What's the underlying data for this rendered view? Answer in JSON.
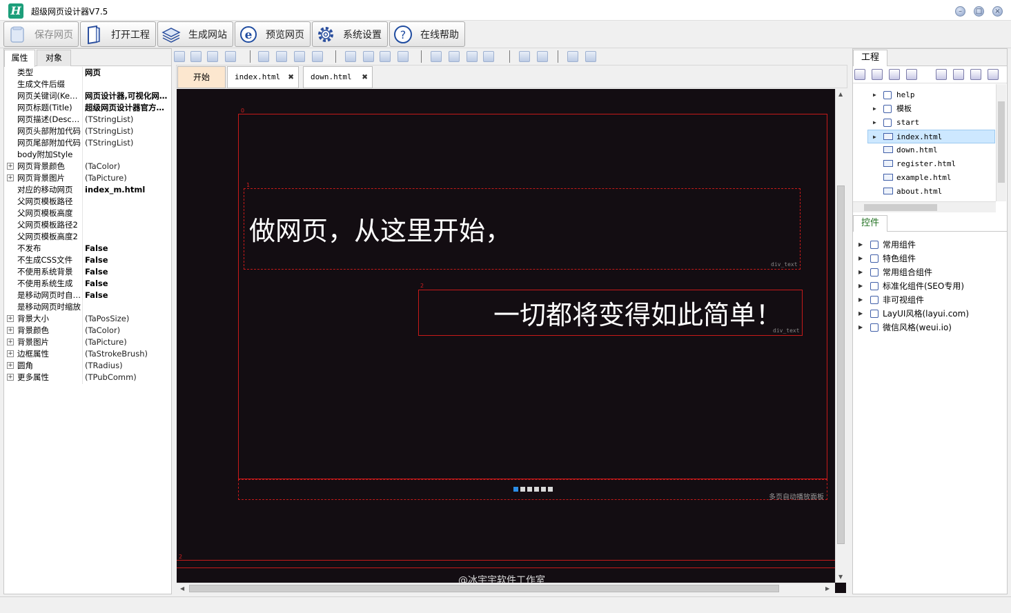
{
  "window": {
    "title": "超级网页设计器V7.5",
    "logo_letter": "H",
    "controls": [
      "minimize",
      "maximize",
      "close"
    ]
  },
  "toolbar": {
    "buttons": [
      {
        "label": "保存网页",
        "icon": "save-icon",
        "enabled": false
      },
      {
        "label": "打开工程",
        "icon": "open-project-icon",
        "enabled": true
      },
      {
        "label": "生成网站",
        "icon": "build-site-icon",
        "enabled": true
      },
      {
        "label": "预览网页",
        "icon": "browser-preview-icon",
        "enabled": true
      },
      {
        "label": "系统设置",
        "icon": "gear-icon",
        "enabled": true
      },
      {
        "label": "在线帮助",
        "icon": "help-icon",
        "enabled": true
      }
    ]
  },
  "left_panel": {
    "tabs": [
      "属性",
      "对象"
    ],
    "active_tab": "属性",
    "properties": [
      {
        "name": "类型",
        "value": "网页",
        "bold": true,
        "expandable": false
      },
      {
        "name": "生成文件后缀",
        "value": "",
        "bold": false,
        "expandable": false
      },
      {
        "name": "网页关键词(Keywords)",
        "value": "网页设计器,可视化网页设计",
        "bold": true,
        "expandable": false
      },
      {
        "name": "网页标题(Title)",
        "value": "超级网页设计器官方网站",
        "bold": true,
        "expandable": false
      },
      {
        "name": "网页描述(Description)",
        "value": "(TStringList)",
        "bold": false,
        "expandable": false
      },
      {
        "name": "网页头部附加代码",
        "value": "(TStringList)",
        "bold": false,
        "expandable": false
      },
      {
        "name": "网页尾部附加代码",
        "value": "(TStringList)",
        "bold": false,
        "expandable": false
      },
      {
        "name": "body附加Style",
        "value": "",
        "bold": false,
        "expandable": false
      },
      {
        "name": "网页背景颜色",
        "value": "(TaColor)",
        "bold": false,
        "expandable": true
      },
      {
        "name": "网页背景图片",
        "value": "(TaPicture)",
        "bold": false,
        "expandable": true
      },
      {
        "name": "对应的移动网页",
        "value": "index_m.html",
        "bold": true,
        "expandable": false
      },
      {
        "name": "父网页模板路径",
        "value": "",
        "bold": false,
        "expandable": false
      },
      {
        "name": "父网页模板高度",
        "value": "",
        "bold": false,
        "expandable": false
      },
      {
        "name": "父网页模板路径2",
        "value": "",
        "bold": false,
        "expandable": false
      },
      {
        "name": "父网页模板高度2",
        "value": "",
        "bold": false,
        "expandable": false
      },
      {
        "name": "不发布",
        "value": "False",
        "bold": true,
        "expandable": false
      },
      {
        "name": "不生成CSS文件",
        "value": "False",
        "bold": true,
        "expandable": false
      },
      {
        "name": "不使用系统背景",
        "value": "False",
        "bold": true,
        "expandable": false
      },
      {
        "name": "不使用系统生成",
        "value": "False",
        "bold": true,
        "expandable": false
      },
      {
        "name": "是移动网页时自适应",
        "value": "False",
        "bold": true,
        "expandable": false
      },
      {
        "name": "是移动网页时缩放",
        "value": "",
        "bold": false,
        "expandable": false
      },
      {
        "name": "背景大小",
        "value": "(TaPosSize)",
        "bold": false,
        "expandable": true
      },
      {
        "name": "背景颜色",
        "value": "(TaColor)",
        "bold": false,
        "expandable": true
      },
      {
        "name": "背景图片",
        "value": "(TaPicture)",
        "bold": false,
        "expandable": true
      },
      {
        "name": "边框属性",
        "value": "(TaStrokeBrush)",
        "bold": false,
        "expandable": true
      },
      {
        "name": "圆角",
        "value": "(TRadius)",
        "bold": false,
        "expandable": true
      },
      {
        "name": "更多属性",
        "value": "(TPubComm)",
        "bold": false,
        "expandable": true
      }
    ]
  },
  "doc_tabs": [
    {
      "label": "开始",
      "closable": false,
      "kind": "start"
    },
    {
      "label": "index.html",
      "closable": true,
      "kind": "doc"
    },
    {
      "label": "down.html",
      "closable": true,
      "kind": "doc"
    }
  ],
  "canvas": {
    "background": "#130d12",
    "accent_red": "#c81a1a",
    "block_indices": [
      "0",
      "1",
      "2",
      "2"
    ],
    "hero_text_1": "做网页，从这里开始，",
    "hero_text_2": "一切都将变得如此简单！",
    "div_tag": "div_text",
    "carousel_label": "多页自动播放面板",
    "carousel_dot_count": 6,
    "carousel_active_dot": 1,
    "footer_text": "@冰宇宇软件工作室"
  },
  "right_panel": {
    "project_tab": "工程",
    "tree": [
      {
        "label": "help",
        "icon": "page-icon",
        "expandable": true,
        "selected": false
      },
      {
        "label": "模板",
        "icon": "page-icon",
        "expandable": true,
        "selected": false
      },
      {
        "label": "start",
        "icon": "page-icon",
        "expandable": true,
        "selected": false
      },
      {
        "label": "index.html",
        "icon": "screen-icon",
        "expandable": true,
        "selected": true
      },
      {
        "label": "down.html",
        "icon": "screen-icon",
        "expandable": false,
        "selected": false
      },
      {
        "label": "register.html",
        "icon": "screen-icon",
        "expandable": false,
        "selected": false
      },
      {
        "label": "example.html",
        "icon": "screen-icon",
        "expandable": false,
        "selected": false
      },
      {
        "label": "about.html",
        "icon": "screen-icon",
        "expandable": false,
        "selected": false
      }
    ],
    "controls_tab": "控件",
    "components": [
      "常用组件",
      "特色组件",
      "常用组合组件",
      "标准化组件(SEO专用)",
      "非可视组件",
      "LayUI风格(layui.com)",
      "微信风格(weui.io)"
    ]
  }
}
